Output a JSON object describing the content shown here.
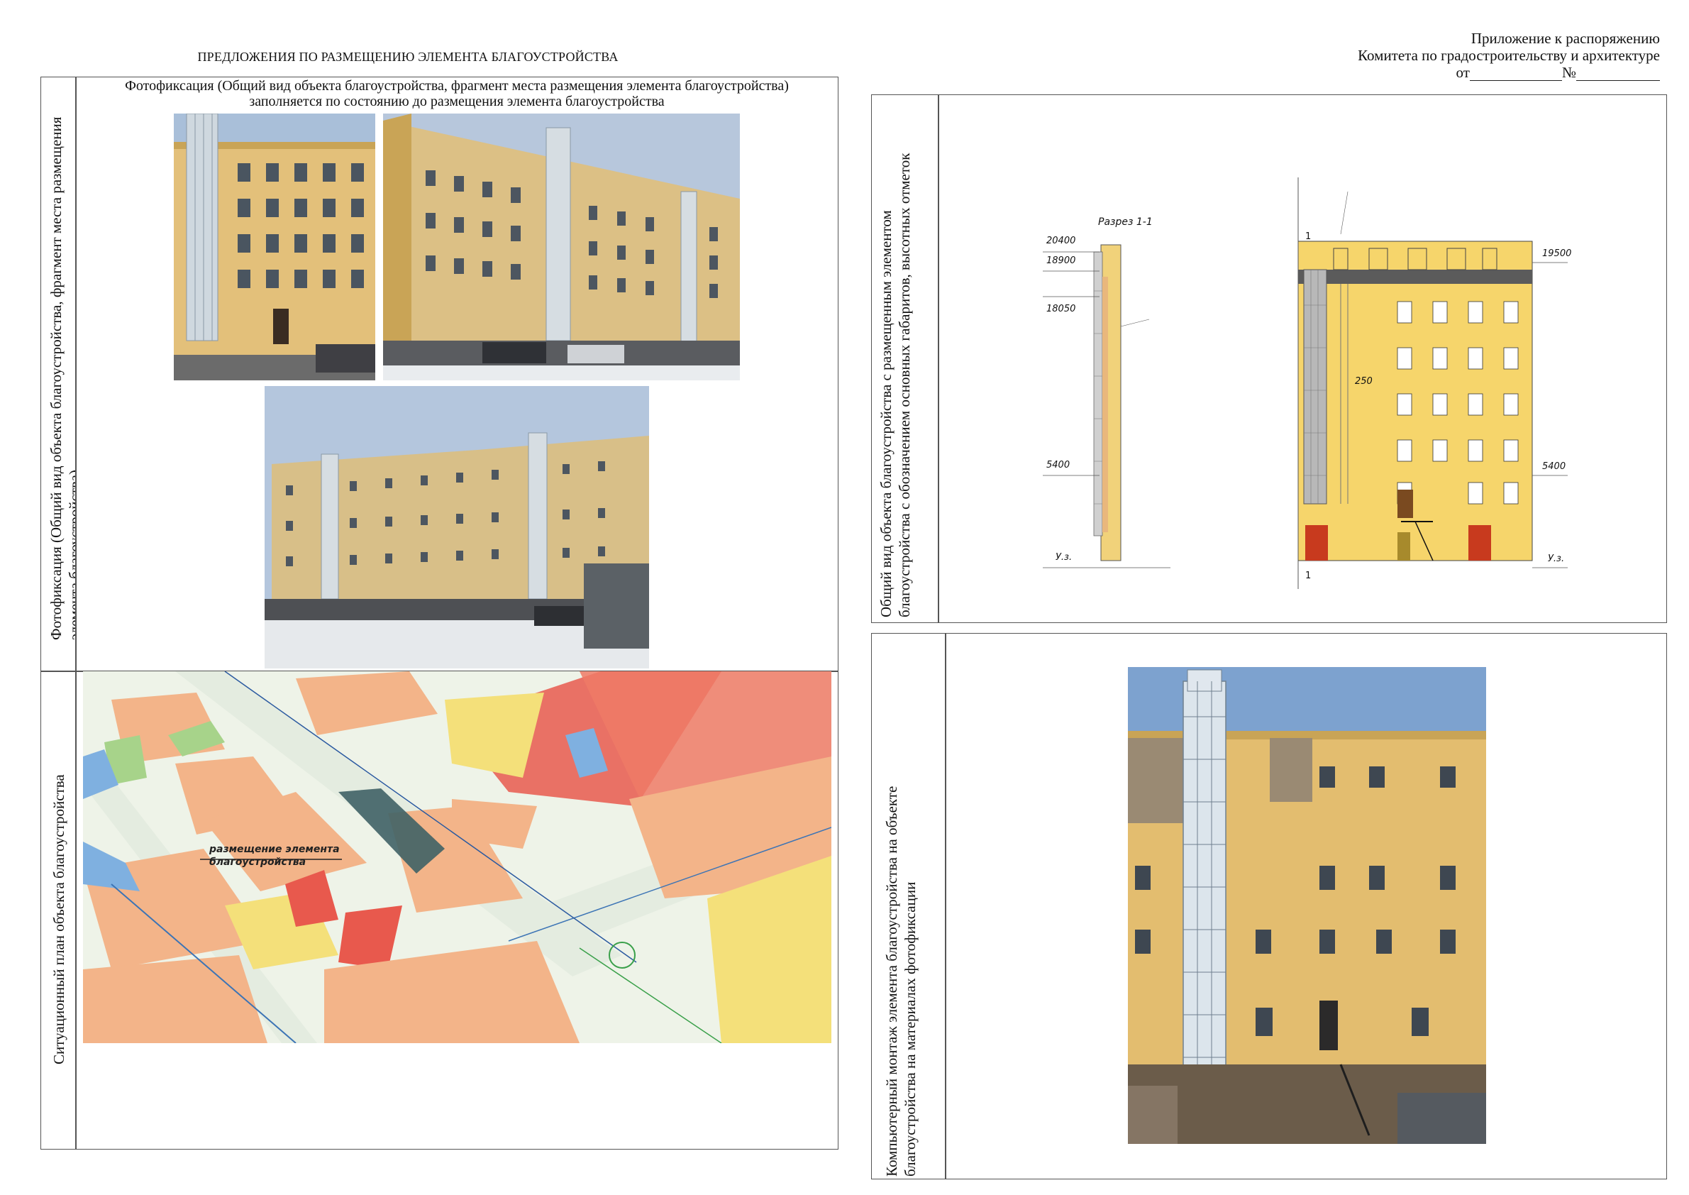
{
  "header": {
    "appendix_line1": "Приложение к распоряжению",
    "appendix_line2": "Комитета по градостроительству и архитектуре",
    "from_label": "от",
    "number_label": "№"
  },
  "left_title": "ПРЕДЛОЖЕНИЯ ПО РАЗМЕЩЕНИЮ ЭЛЕМЕНТА БЛАГОУСТРОЙСТВА",
  "photo_section": {
    "side_label": "Фотофиксация (Общий вид объекта благоустройства, фрагмент места размещения элемента благоустройства)",
    "caption_line1": "Фотофиксация (Общий вид объекта благоустройства, фрагмент места размещения элемента благоустройства)",
    "caption_line2": "заполняется по состоянию до размещения элемента благоустройства"
  },
  "plan_section": {
    "side_label": "Ситуационный план объекта благоустройства",
    "map_label_line1": "размещение элемента",
    "map_label_line2": "благоустройства"
  },
  "drawing_section": {
    "side_label": "Общий вид объекта благоустройства с размещенным элементом благоустройства с обозначением основных габаритов, высотных отметок",
    "section_title": "Разрез 1-1",
    "marks_left": [
      "20400",
      "18900",
      "18050",
      "5400",
      "У.з."
    ],
    "marks_right": [
      "19500",
      "250",
      "5400",
      "У.з."
    ],
    "axis_mark": "1"
  },
  "montage_section": {
    "side_label": "Компьютерный монтаж элемента благоустройства на объекте благоустройства на материалах фотофиксации"
  },
  "colors": {
    "facade_yellow": "#e8c46a",
    "facade_shadow": "#c9a456",
    "sky_blue": "#9fb6d4",
    "map_red": "#e8594d",
    "map_orange": "#f3b489",
    "map_yellow": "#f4e07a",
    "map_green": "#a7d38a",
    "map_blue": "#7fb0e0",
    "border": "#555555"
  }
}
